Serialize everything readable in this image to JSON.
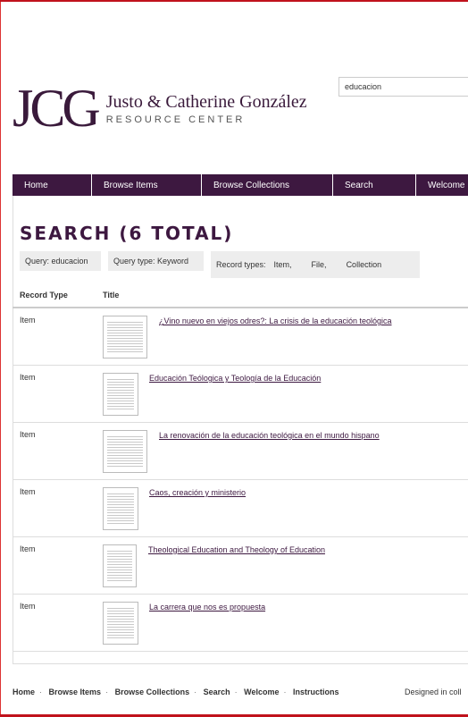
{
  "logo": {
    "mark": "JCG",
    "name": "Justo & Catherine González",
    "subtitle": "RESOURCE CENTER"
  },
  "search": {
    "value": "educacion"
  },
  "nav": [
    "Home",
    "Browse Items",
    "Browse Collections",
    "Search",
    "Welcome"
  ],
  "page_title": "SEARCH (6 TOTAL)",
  "filters": {
    "query": "Query: educacion",
    "query_type": "Query type: Keyword",
    "record_types_label": "Record types:",
    "record_types": [
      "Item,",
      "File,",
      "Collection"
    ]
  },
  "table": {
    "headers": [
      "Record Type",
      "Title"
    ],
    "rows": [
      {
        "type": "Item",
        "title": "¿Vino nuevo en viejos odres?: La crisis de la educación teológica"
      },
      {
        "type": "Item",
        "title": "Educación Teólogica y Teología de la Educación"
      },
      {
        "type": "Item",
        "title": "La renovación de la educación teológica en el mundo hispano"
      },
      {
        "type": "Item",
        "title": "Caos, creación y ministerio"
      },
      {
        "type": "Item",
        "title": "Theological Education and Theology of Education"
      },
      {
        "type": "Item",
        "title": "La carrera que nos es propuesta"
      }
    ]
  },
  "footer": {
    "links": [
      "Home",
      "Browse Items",
      "Browse Collections",
      "Search",
      "Welcome",
      "Instructions"
    ],
    "designed": "Designed in coll"
  }
}
